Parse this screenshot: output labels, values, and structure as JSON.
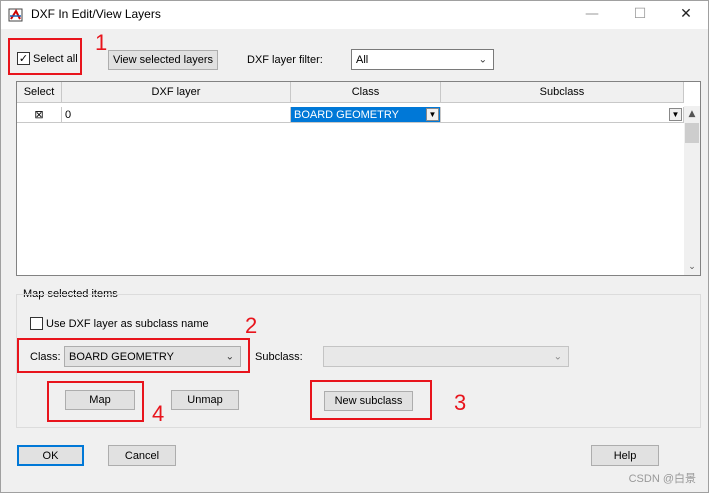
{
  "window": {
    "title": "DXF In Edit/View Layers",
    "minimize": "—",
    "maximize": "☐",
    "close": "✕"
  },
  "toolbar": {
    "select_all_label": "Select all",
    "select_all_checked": "✓",
    "view_selected_label": "View selected layers",
    "filter_label": "DXF layer filter:",
    "filter_value": "All"
  },
  "grid": {
    "columns": [
      "Select",
      "DXF layer",
      "Class",
      "Subclass"
    ],
    "rows": [
      {
        "select": "⊠",
        "layer": "0",
        "class": "BOARD GEOMETRY",
        "subclass": ""
      }
    ]
  },
  "map_group": {
    "title": "Map selected items",
    "use_dxf_label": "Use DXF layer as subclass name",
    "class_label": "Class:",
    "class_value": "BOARD GEOMETRY",
    "subclass_label": "Subclass:",
    "subclass_value": "",
    "map_label": "Map",
    "unmap_label": "Unmap",
    "new_subclass_label": "New subclass"
  },
  "footer": {
    "ok_label": "OK",
    "cancel_label": "Cancel",
    "help_label": "Help"
  },
  "annotations": [
    "1",
    "2",
    "3",
    "4"
  ],
  "watermark": "CSDN @白景",
  "colors": {
    "accent": "#0078d7",
    "annotation": "#e8141c"
  }
}
